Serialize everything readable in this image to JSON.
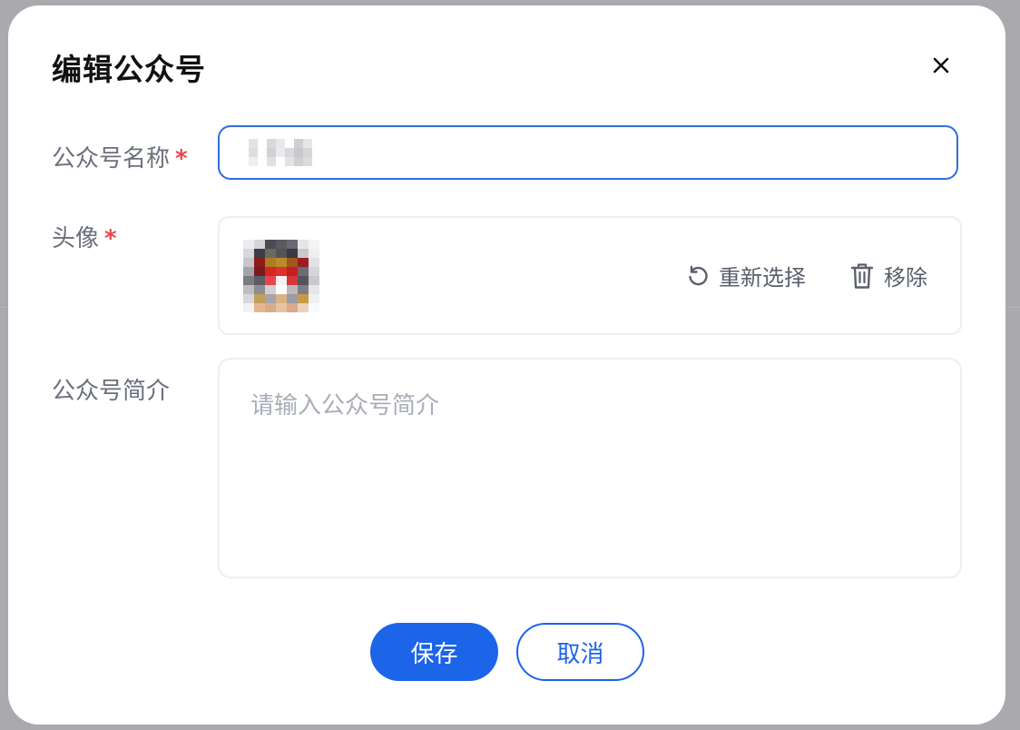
{
  "dialog": {
    "title": "编辑公众号",
    "close_icon": "close-icon"
  },
  "form": {
    "name_label": "公众号名称",
    "avatar_label": "头像",
    "intro_label": "公众号简介",
    "required_mark": "*",
    "intro_placeholder": "请输入公众号简介"
  },
  "avatar_actions": {
    "reselect": "重新选择",
    "reselect_icon": "refresh-icon",
    "remove": "移除",
    "remove_icon": "trash-icon"
  },
  "footer": {
    "save": "保存",
    "cancel": "取消"
  },
  "colors": {
    "primary": "#1c64e8",
    "required": "#e5484d"
  }
}
